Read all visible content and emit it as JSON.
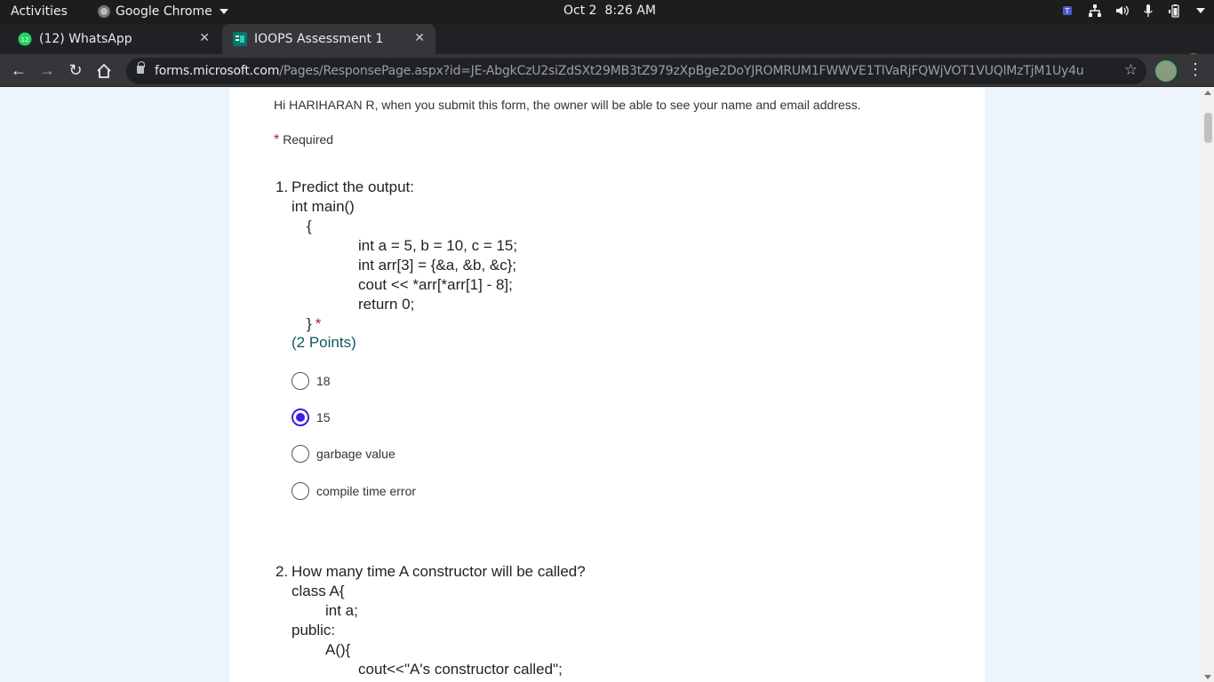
{
  "topbar": {
    "activities": "Activities",
    "app_name": "Google Chrome",
    "date": "Oct 2",
    "time": "8:26 AM",
    "tray_icons": [
      "teams-icon",
      "network-icon",
      "volume-icon",
      "microphone-icon",
      "battery-icon",
      "system-menu-caret-icon"
    ]
  },
  "tabs": [
    {
      "title": "(12) WhatsApp",
      "badge": "12",
      "favicon": "whatsapp-icon",
      "active": false
    },
    {
      "title": "IOOPS Assessment 1",
      "favicon": "microsoft-forms-icon",
      "active": true
    }
  ],
  "toolbar": {
    "url_host": "forms.microsoft.com",
    "url_path": "/Pages/ResponsePage.aspx?id=JE-AbgkCzU2siZdSXt29MB3tZ979zXpBge2DoYJROMRUM1FWWVE1TlVaRjFQWjVOT1VUQlMzTjM1Uy4u"
  },
  "form": {
    "intro": "Hi HARIHARAN R, when you submit this form, the owner will be able to see your name and email address.",
    "required_label": "Required",
    "q1": {
      "number": "1.",
      "title": "Predict the output:",
      "code": [
        "int main()",
        "{",
        "int a = 5, b = 10, c = 15;",
        "int arr[3] = {&a, &b, &c};",
        "cout << *arr[*arr[1] - 8];",
        "return 0;",
        "}"
      ],
      "points": "(2 Points)",
      "options": [
        "18",
        "15",
        "garbage value",
        "compile time error"
      ],
      "selected": "15"
    },
    "q2": {
      "number": "2.",
      "title": "How many time A constructor will be called?",
      "code": [
        "class A{",
        "int a;",
        "public:",
        "A(){",
        "cout<<\"A's constructor called\";"
      ]
    }
  },
  "colors": {
    "accent": "#3a1fe6",
    "required": "#a4262c",
    "points": "#0b5a62",
    "page_bg": "#eef4fb"
  }
}
